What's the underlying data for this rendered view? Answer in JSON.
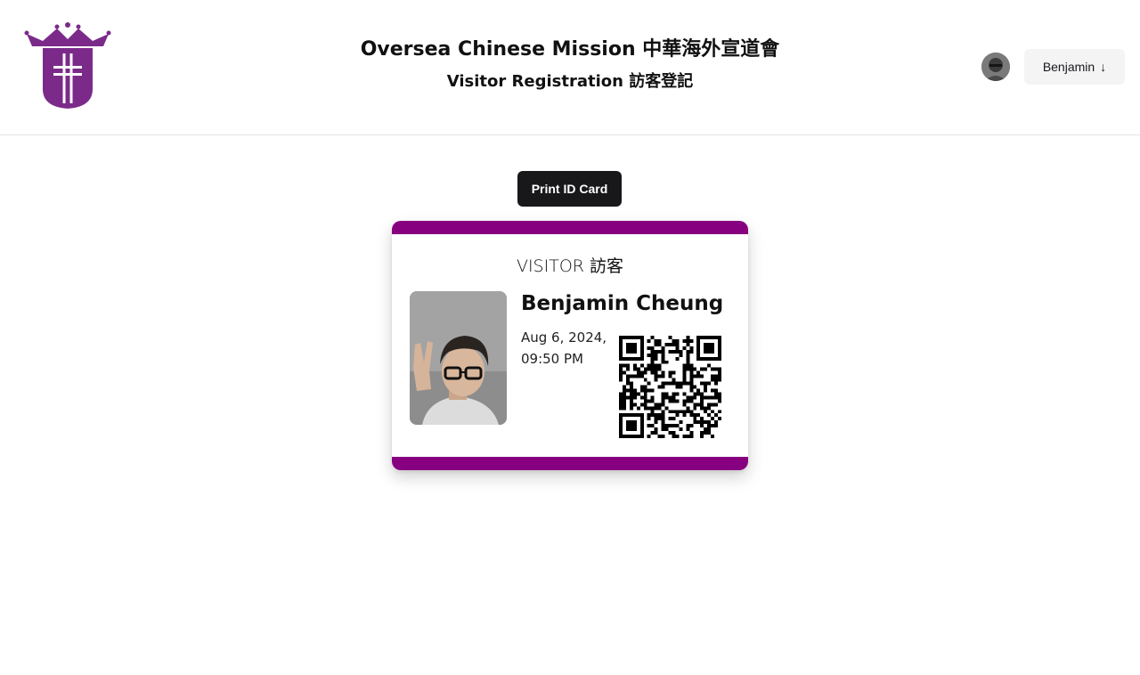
{
  "header": {
    "org_title": "Oversea Chinese Mission 中華海外宣道會",
    "page_subtitle": "Visitor Registration 訪客登記",
    "logo_icon": "church-crown-cross-logo",
    "brand_color": "#7b2a8a"
  },
  "user": {
    "name": "Benjamin",
    "menu_arrow": "↓",
    "avatar_icon": "user-avatar"
  },
  "actions": {
    "print_label": "Print ID Card"
  },
  "card": {
    "label": "VISITOR 訪客",
    "visitor_name": "Benjamin Cheung",
    "date": "Aug 6, 2024,",
    "time": "09:50 PM",
    "accent_color": "#870080",
    "qr_icon": "qr-code",
    "photo_icon": "visitor-photo"
  }
}
